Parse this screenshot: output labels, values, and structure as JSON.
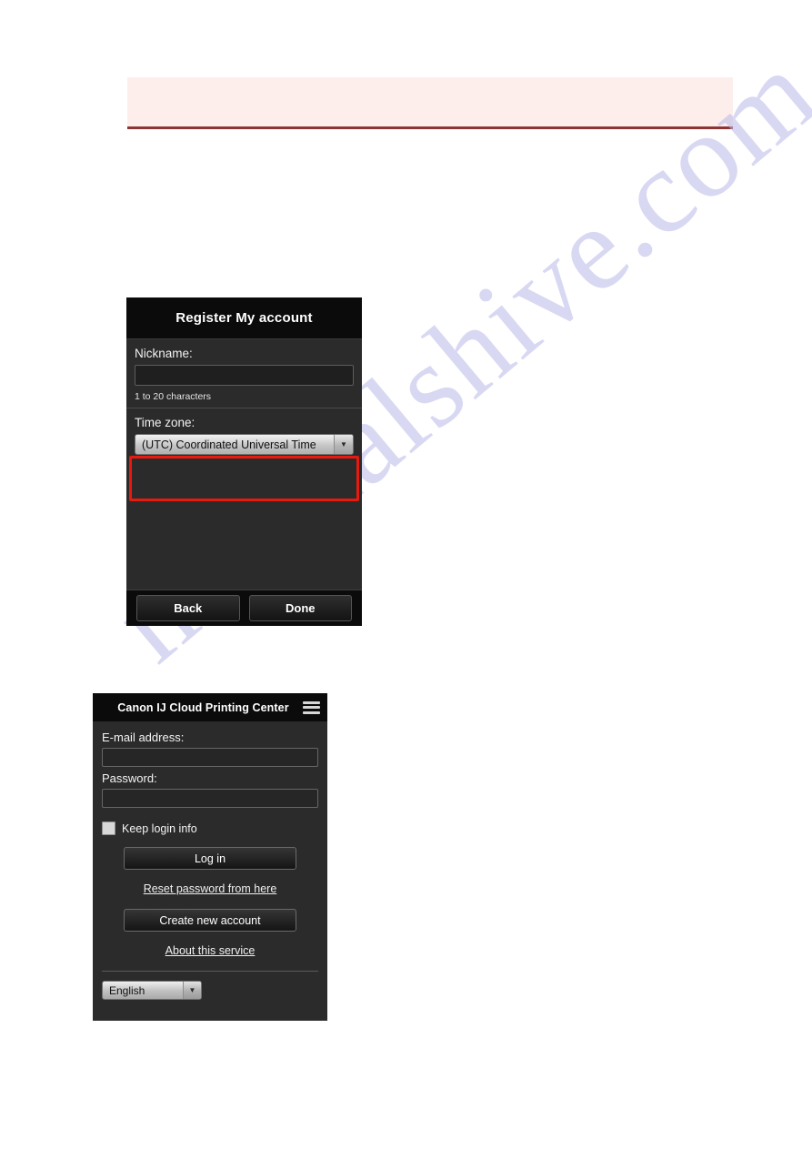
{
  "page": {
    "background_color": "#ffffff",
    "watermark_text": "manualshive.com",
    "watermark_color": "#b9b9e8"
  },
  "notice_banner": {
    "text": "",
    "background_color": "#fdeeec",
    "border_color": "#8d3535"
  },
  "register_panel": {
    "title": "Register My account",
    "nickname": {
      "label": "Nickname:",
      "value": "",
      "placeholder": "",
      "hint": "1 to 20 characters"
    },
    "timezone": {
      "label": "Time zone:",
      "selected": "(UTC) Coordinated Universal Time",
      "arrow_glyph": "▼"
    },
    "highlight_color": "#e8190f",
    "footer": {
      "back_label": "Back",
      "done_label": "Done"
    }
  },
  "login_panel": {
    "title": "Canon IJ Cloud Printing Center",
    "menu_icon": "hamburger-menu-icon",
    "email": {
      "label": "E-mail address:",
      "value": "",
      "placeholder": ""
    },
    "password": {
      "label": "Password:",
      "value": "",
      "placeholder": ""
    },
    "keep_login": {
      "label": "Keep login info",
      "checked": false
    },
    "login_button": "Log in",
    "reset_password_link": "Reset password from here",
    "create_account_button": "Create new account",
    "about_link": "About this service",
    "language": {
      "selected": "English",
      "arrow_glyph": "▼"
    }
  }
}
